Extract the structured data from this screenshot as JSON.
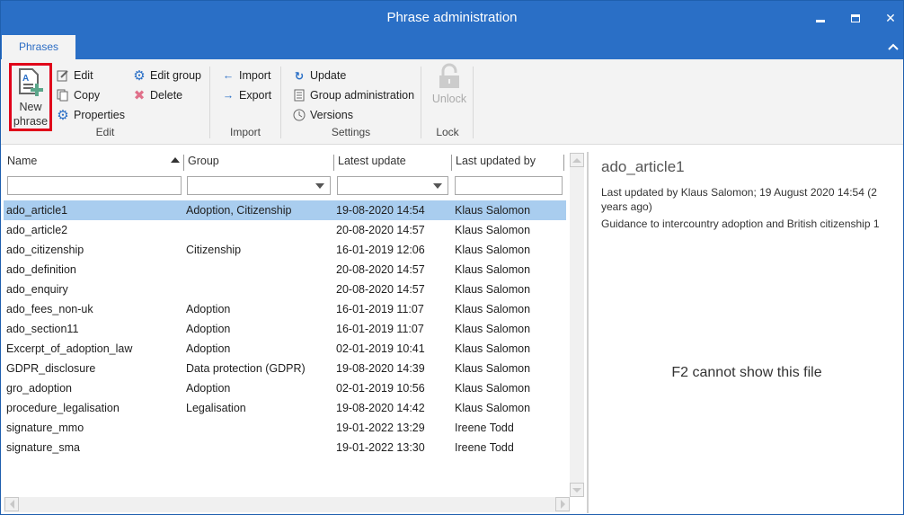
{
  "window": {
    "title": "Phrase administration"
  },
  "tabs": [
    {
      "label": "Phrases",
      "active": true
    }
  ],
  "ribbon": {
    "new_phrase": {
      "line1": "New",
      "line2": "phrase"
    },
    "edit_group": {
      "label": "Edit",
      "items": {
        "edit": "Edit",
        "copy": "Copy",
        "properties": "Properties",
        "edit_group": "Edit group",
        "delete": "Delete"
      }
    },
    "import_group": {
      "label": "Import",
      "items": {
        "import": "Import",
        "export": "Export"
      }
    },
    "settings_group": {
      "label": "Settings",
      "items": {
        "update": "Update",
        "group_admin": "Group administration",
        "versions": "Versions"
      }
    },
    "lock_group": {
      "label": "Lock",
      "items": {
        "unlock": "Unlock"
      }
    }
  },
  "table": {
    "columns": {
      "name": "Name",
      "group": "Group",
      "latest_update": "Latest update",
      "last_updated_by": "Last updated by"
    },
    "sort": {
      "column": "name",
      "direction": "ascending"
    },
    "filters": {
      "name": "",
      "group": "",
      "latest_update": "",
      "last_updated_by": ""
    },
    "rows": [
      {
        "name": "ado_article1",
        "group": "Adoption, Citizenship",
        "latest_update": "19-08-2020 14:54",
        "last_updated_by": "Klaus Salomon",
        "selected": true
      },
      {
        "name": "ado_article2",
        "group": "",
        "latest_update": "20-08-2020 14:57",
        "last_updated_by": "Klaus Salomon"
      },
      {
        "name": "ado_citizenship",
        "group": "Citizenship",
        "latest_update": "16-01-2019 12:06",
        "last_updated_by": "Klaus Salomon"
      },
      {
        "name": "ado_definition",
        "group": "",
        "latest_update": "20-08-2020 14:57",
        "last_updated_by": "Klaus Salomon"
      },
      {
        "name": "ado_enquiry",
        "group": "",
        "latest_update": "20-08-2020 14:57",
        "last_updated_by": "Klaus Salomon"
      },
      {
        "name": "ado_fees_non-uk",
        "group": "Adoption",
        "latest_update": "16-01-2019 11:07",
        "last_updated_by": "Klaus Salomon"
      },
      {
        "name": "ado_section11",
        "group": "Adoption",
        "latest_update": "16-01-2019 11:07",
        "last_updated_by": "Klaus Salomon"
      },
      {
        "name": "Excerpt_of_adoption_law",
        "group": "Adoption",
        "latest_update": "02-01-2019 10:41",
        "last_updated_by": "Klaus Salomon"
      },
      {
        "name": "GDPR_disclosure",
        "group": "Data protection (GDPR)",
        "latest_update": "19-08-2020 14:39",
        "last_updated_by": "Klaus Salomon"
      },
      {
        "name": "gro_adoption",
        "group": "Adoption",
        "latest_update": "02-01-2019 10:56",
        "last_updated_by": "Klaus Salomon"
      },
      {
        "name": "procedure_legalisation",
        "group": "Legalisation",
        "latest_update": "19-08-2020 14:42",
        "last_updated_by": "Klaus Salomon"
      },
      {
        "name": "signature_mmo",
        "group": "",
        "latest_update": "19-01-2022 13:29",
        "last_updated_by": "Ireene Todd"
      },
      {
        "name": "signature_sma",
        "group": "",
        "latest_update": "19-01-2022 13:30",
        "last_updated_by": "Ireene Todd"
      }
    ]
  },
  "detail": {
    "title": "ado_article1",
    "meta": "Last updated by Klaus Salomon; 19 August 2020 14:54 (2 years ago)",
    "description": "Guidance to intercountry adoption and British citizenship 1",
    "preview_message": "F2 cannot show this file"
  },
  "colors": {
    "accent": "#2a6fc6",
    "selection": "#a9cdef",
    "highlight_border": "#e0001a"
  }
}
